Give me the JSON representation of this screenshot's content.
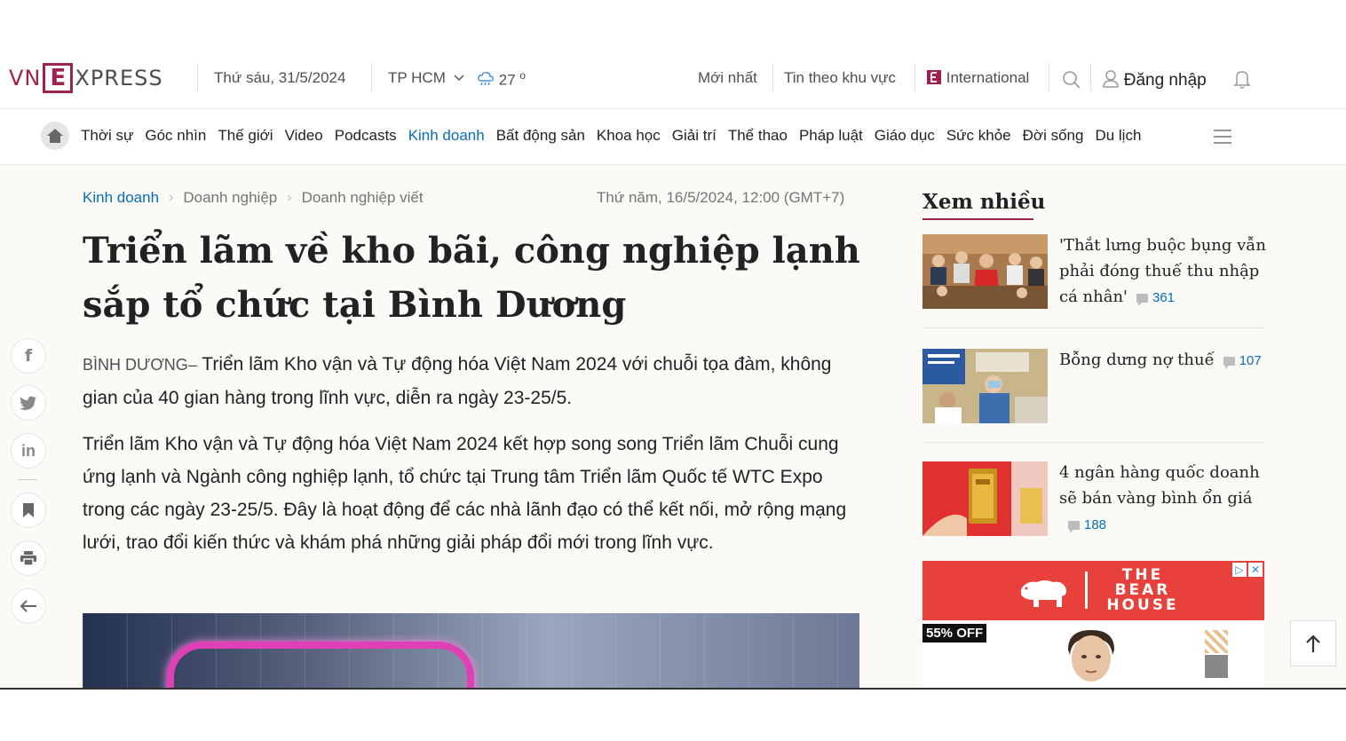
{
  "header": {
    "logo": {
      "left": "VN",
      "box": "E",
      "right": "XPRESS"
    },
    "date": "Thứ sáu, 31/5/2024",
    "city": "TP HCM",
    "temperature": "27",
    "temperature_unit": "o",
    "links": {
      "latest": "Mới nhất",
      "regional": "Tin theo khu vực",
      "international": "International"
    },
    "login": "Đăng nhập"
  },
  "nav": {
    "items": [
      {
        "label": "Thời sự"
      },
      {
        "label": "Góc nhìn"
      },
      {
        "label": "Thế giới"
      },
      {
        "label": "Video"
      },
      {
        "label": "Podcasts"
      },
      {
        "label": "Kinh doanh",
        "active": true
      },
      {
        "label": "Bất động sản"
      },
      {
        "label": "Khoa học"
      },
      {
        "label": "Giải trí"
      },
      {
        "label": "Thể thao"
      },
      {
        "label": "Pháp luật"
      },
      {
        "label": "Giáo dục"
      },
      {
        "label": "Sức khỏe"
      },
      {
        "label": "Đời sống"
      },
      {
        "label": "Du lịch"
      }
    ]
  },
  "article": {
    "breadcrumb": [
      "Kinh doanh",
      "Doanh nghiệp",
      "Doanh nghiệp viết"
    ],
    "date": "Thứ năm, 16/5/2024, 12:00 (GMT+7)",
    "title": "Triển lãm về kho bãi, công nghiệp lạnh sắp tổ chức tại Bình Dương",
    "location": "BÌNH DƯƠNG",
    "location_separator": "–",
    "lead": "Triển lãm Kho vận và Tự động hóa Việt Nam 2024 với chuỗi tọa đàm, không gian của 40 gian hàng trong lĩnh vực, diễn ra ngày 23-25/5.",
    "paragraph": "Triển lãm Kho vận và Tự động hóa Việt Nam 2024 kết hợp song song Triển lãm Chuỗi cung ứng lạnh và Ngành công nghiệp lạnh, tổ chức tại Trung tâm Triển lãm Quốc tế WTC Expo trong các ngày 23-25/5. Đây là hoạt động để các nhà lãnh đạo có thể kết nối, mở rộng mạng lưới, trao đổi kiến thức và khám phá những giải pháp đổi mới trong lĩnh vực."
  },
  "sidebar": {
    "title": "Xem nhiều",
    "items": [
      {
        "title": "'Thắt lưng buộc bụng vẫn phải đóng thuế thu nhập cá nhân'",
        "comments": "361"
      },
      {
        "title": "Bỗng dưng nợ thuế",
        "comments": "107"
      },
      {
        "title": "4 ngân hàng quốc doanh sẽ bán vàng bình ổn giá",
        "comments": "188"
      }
    ]
  },
  "ad": {
    "brand_lines": [
      "THE",
      "BEAR",
      "HOUSE"
    ],
    "badge": "55% OFF",
    "choices_icon": "▷",
    "close_icon": "✕"
  },
  "colors": {
    "brand": "#9f224e",
    "link": "#076db6",
    "background": "#fcfaf6"
  }
}
